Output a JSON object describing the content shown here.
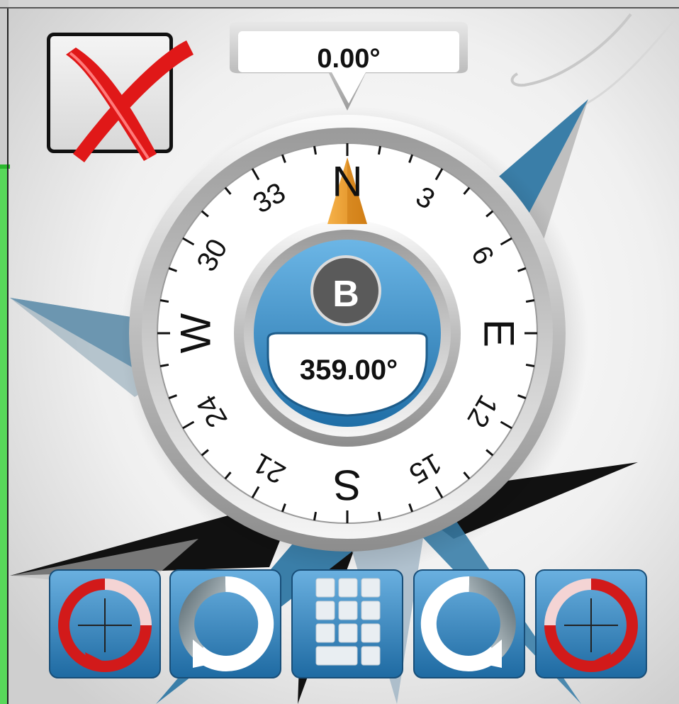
{
  "compass": {
    "heading_readout": "0.00°",
    "bearing_letter": "B",
    "bearing_readout": "359.00°",
    "cardinals": [
      "N",
      "E",
      "S",
      "W"
    ],
    "numerals": [
      "3",
      "6",
      "12",
      "15",
      "21",
      "24",
      "30",
      "33"
    ],
    "needle_color": "#f0a030",
    "accent_color": "#3a8cc4"
  },
  "close": {
    "icon": "close-icon",
    "color": "#e01818"
  },
  "toolbar": {
    "buttons": [
      {
        "icon": "rotate-left-fine-icon"
      },
      {
        "icon": "rotate-left-icon"
      },
      {
        "icon": "keypad-icon"
      },
      {
        "icon": "rotate-right-icon"
      },
      {
        "icon": "rotate-right-fine-icon"
      }
    ]
  }
}
